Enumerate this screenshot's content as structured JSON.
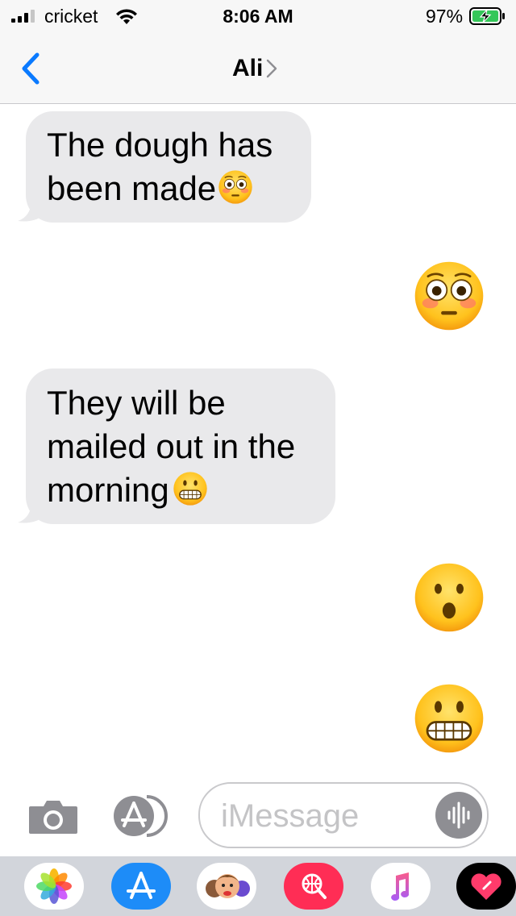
{
  "status_bar": {
    "carrier": "cricket",
    "time": "8:06 AM",
    "battery": "97%"
  },
  "nav": {
    "contact_name": "Ali"
  },
  "messages": [
    {
      "direction": "incoming",
      "text": "The dough has\nbeen made",
      "emoji": "flushed-face-emoji"
    },
    {
      "direction": "outgoing",
      "emoji": "flushed-face-emoji"
    },
    {
      "direction": "incoming",
      "text": "They will be\nmailed out in the\nmorning",
      "emoji": "grimacing-face-emoji"
    },
    {
      "direction": "outgoing",
      "emoji": "hushed-face-emoji"
    },
    {
      "direction": "outgoing",
      "emoji": "grimacing-face-emoji"
    }
  ],
  "compose": {
    "placeholder": "iMessage"
  },
  "app_drawer": [
    "photos-app-icon",
    "app-store-icon",
    "memoji-stickers-icon",
    "web-images-search-icon",
    "music-app-icon",
    "digital-touch-icon"
  ],
  "colors": {
    "accent": "#0a7aff",
    "bubble_gray": "#e9e9eb",
    "battery_green": "#34c759"
  }
}
